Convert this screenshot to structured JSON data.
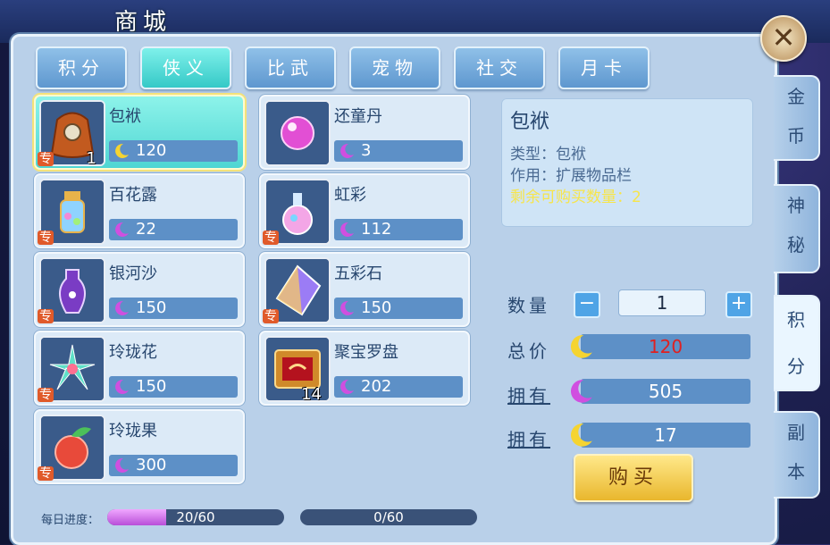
{
  "screen": {
    "title": "商城"
  },
  "tabs": [
    {
      "label": "积分",
      "active": false
    },
    {
      "label": "侠义",
      "active": true
    },
    {
      "label": "比武",
      "active": false
    },
    {
      "label": "宠物",
      "active": false
    },
    {
      "label": "社交",
      "active": false
    },
    {
      "label": "月卡",
      "active": false
    }
  ],
  "items": [
    {
      "name": "包袱",
      "price": "120",
      "currency": "moon-yellow",
      "zhuan": "专",
      "count": "1",
      "selected": true,
      "icon": "bag-icon"
    },
    {
      "name": "还童丹",
      "price": "3",
      "currency": "moon-pink",
      "icon": "pill-orb-icon"
    },
    {
      "name": "百花露",
      "price": "22",
      "currency": "moon-pink",
      "zhuan": "专",
      "icon": "flower-jar-icon"
    },
    {
      "name": "虹彩",
      "price": "112",
      "currency": "moon-pink",
      "zhuan": "专",
      "icon": "perfume-bottle-icon"
    },
    {
      "name": "银河沙",
      "price": "150",
      "currency": "moon-pink",
      "zhuan": "专",
      "icon": "galaxy-vase-icon"
    },
    {
      "name": "五彩石",
      "price": "150",
      "currency": "moon-pink",
      "zhuan": "专",
      "icon": "rainbow-gem-icon"
    },
    {
      "name": "玲珑花",
      "price": "150",
      "currency": "moon-pink",
      "zhuan": "专",
      "icon": "crystal-flower-icon"
    },
    {
      "name": "聚宝罗盘",
      "price": "202",
      "currency": "moon-pink",
      "count": "14",
      "icon": "compass-box-icon"
    },
    {
      "name": "玲珑果",
      "price": "300",
      "currency": "moon-pink",
      "zhuan": "专",
      "icon": "fruit-icon"
    }
  ],
  "detail": {
    "name": "包袱",
    "type_line": "类型：包袱",
    "use_line": "作用：扩展物品栏",
    "remain_line": "剩余可购买数量：2"
  },
  "purchase": {
    "quantity_label": "数量",
    "minus": "−",
    "plus": "+",
    "quantity": "1",
    "total_label": "总价",
    "total": "120",
    "own_label_1": "拥有",
    "own_1": "505",
    "own_label_2": "拥有",
    "own_2": "17",
    "buy_label": "购买"
  },
  "side_tabs": [
    {
      "label": [
        "金",
        "币"
      ],
      "active": false
    },
    {
      "label": [
        "神",
        "秘"
      ],
      "active": false
    },
    {
      "label": [
        "积",
        "分"
      ],
      "active": true
    },
    {
      "label": [
        "副",
        "本"
      ],
      "active": false
    }
  ],
  "progress": {
    "label": "每日进度：",
    "pink_text": "20/60",
    "pink_fraction": 0.333,
    "yellow_text": "0/60",
    "yellow_fraction": 0
  },
  "colors": {
    "moon_yellow": "#f5d431",
    "moon_pink": "#d04fe0",
    "total_price": "#e02020",
    "remain_text": "#f7e54a"
  }
}
